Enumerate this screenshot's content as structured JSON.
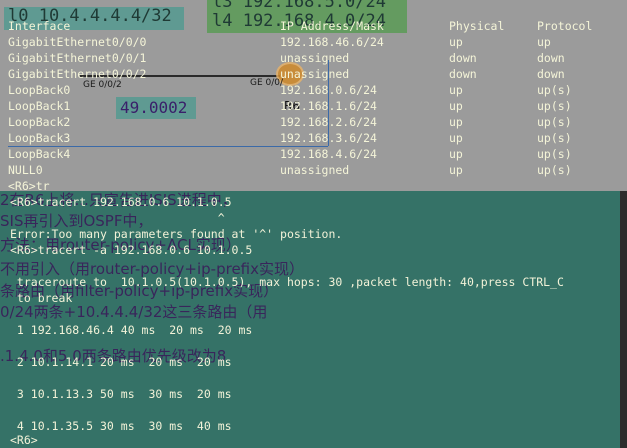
{
  "topology": {
    "loopback_boxes": [
      "l0 10.4.4.4.4/32",
      "l3 192.168.5.0/24",
      "l4 192.168.4.0/24"
    ],
    "area_label": "49.0002",
    "ports": [
      "GE 0/0/2",
      "GE 0/0/"
    ],
    "router_label": "R6"
  },
  "interface_table": {
    "headers": [
      "Interface",
      "IP Address/Mask",
      "Physical",
      "Protocol"
    ],
    "rows": [
      {
        "iface": "GigabitEthernet0/0/0",
        "ip": "192.168.46.6/24",
        "phy": "up",
        "proto": "up"
      },
      {
        "iface": "GigabitEthernet0/0/1",
        "ip": "unassigned",
        "phy": "down",
        "proto": "down"
      },
      {
        "iface": "GigabitEthernet0/0/2",
        "ip": "unassigned",
        "phy": "down",
        "proto": "down"
      },
      {
        "iface": "LoopBack0",
        "ip": "192.168.0.6/24",
        "phy": "up",
        "proto": "up(s)"
      },
      {
        "iface": "LoopBack1",
        "ip": "192.168.1.6/24",
        "phy": "up",
        "proto": "up(s)"
      },
      {
        "iface": "LoopBack2",
        "ip": "192.168.2.6/24",
        "phy": "up",
        "proto": "up(s)"
      },
      {
        "iface": "LoopBack3",
        "ip": "192.168.3.6/24",
        "phy": "up",
        "proto": "up(s)"
      },
      {
        "iface": "LoopBack4",
        "ip": "192.168.4.6/24",
        "phy": "up",
        "proto": "up(s)"
      },
      {
        "iface": "NULL0",
        "ip": "unassigned",
        "phy": "up",
        "proto": "up(s)"
      }
    ],
    "prompt_line": "<R6>tr"
  },
  "terminal": {
    "lines": [
      "<R6>tracert 192.168.0.6 10.1.0.5",
      "                              ^",
      "Error:Too many parameters found at '^' position.",
      "<R6>tracert -a 192.168.0.6 10.1.0.5",
      "",
      " traceroute to  10.1.0.5(10.1.0.5), max hops: 30 ,packet length: 40,press CTRL_C",
      " to break",
      "",
      " 1 192.168.46.4 40 ms  20 ms  20 ms",
      "",
      " 2 10.1.14.1 20 ms  20 ms  20 ms",
      "",
      " 3 10.1.13.3 50 ms  30 ms  20 ms",
      "",
      " 4 10.1.35.5 30 ms  30 ms  40 ms",
      "",
      "<R6>"
    ]
  },
  "notes": [
    "2在R6上将...只宣告进ISIS进程中，",
    "SIS再引入到OSPF中，",
    "方法：用router-policy+ACL实现）",
    "不用引入（用router-policy+ip-prefix实现）",
    "条路由（用filter-policy+ip-prefix实现）",
    "0/24两条+10.4.4.4/32这三条路由（用",
    ".1.4.0和5.0两条路由优先级改为8"
  ]
}
